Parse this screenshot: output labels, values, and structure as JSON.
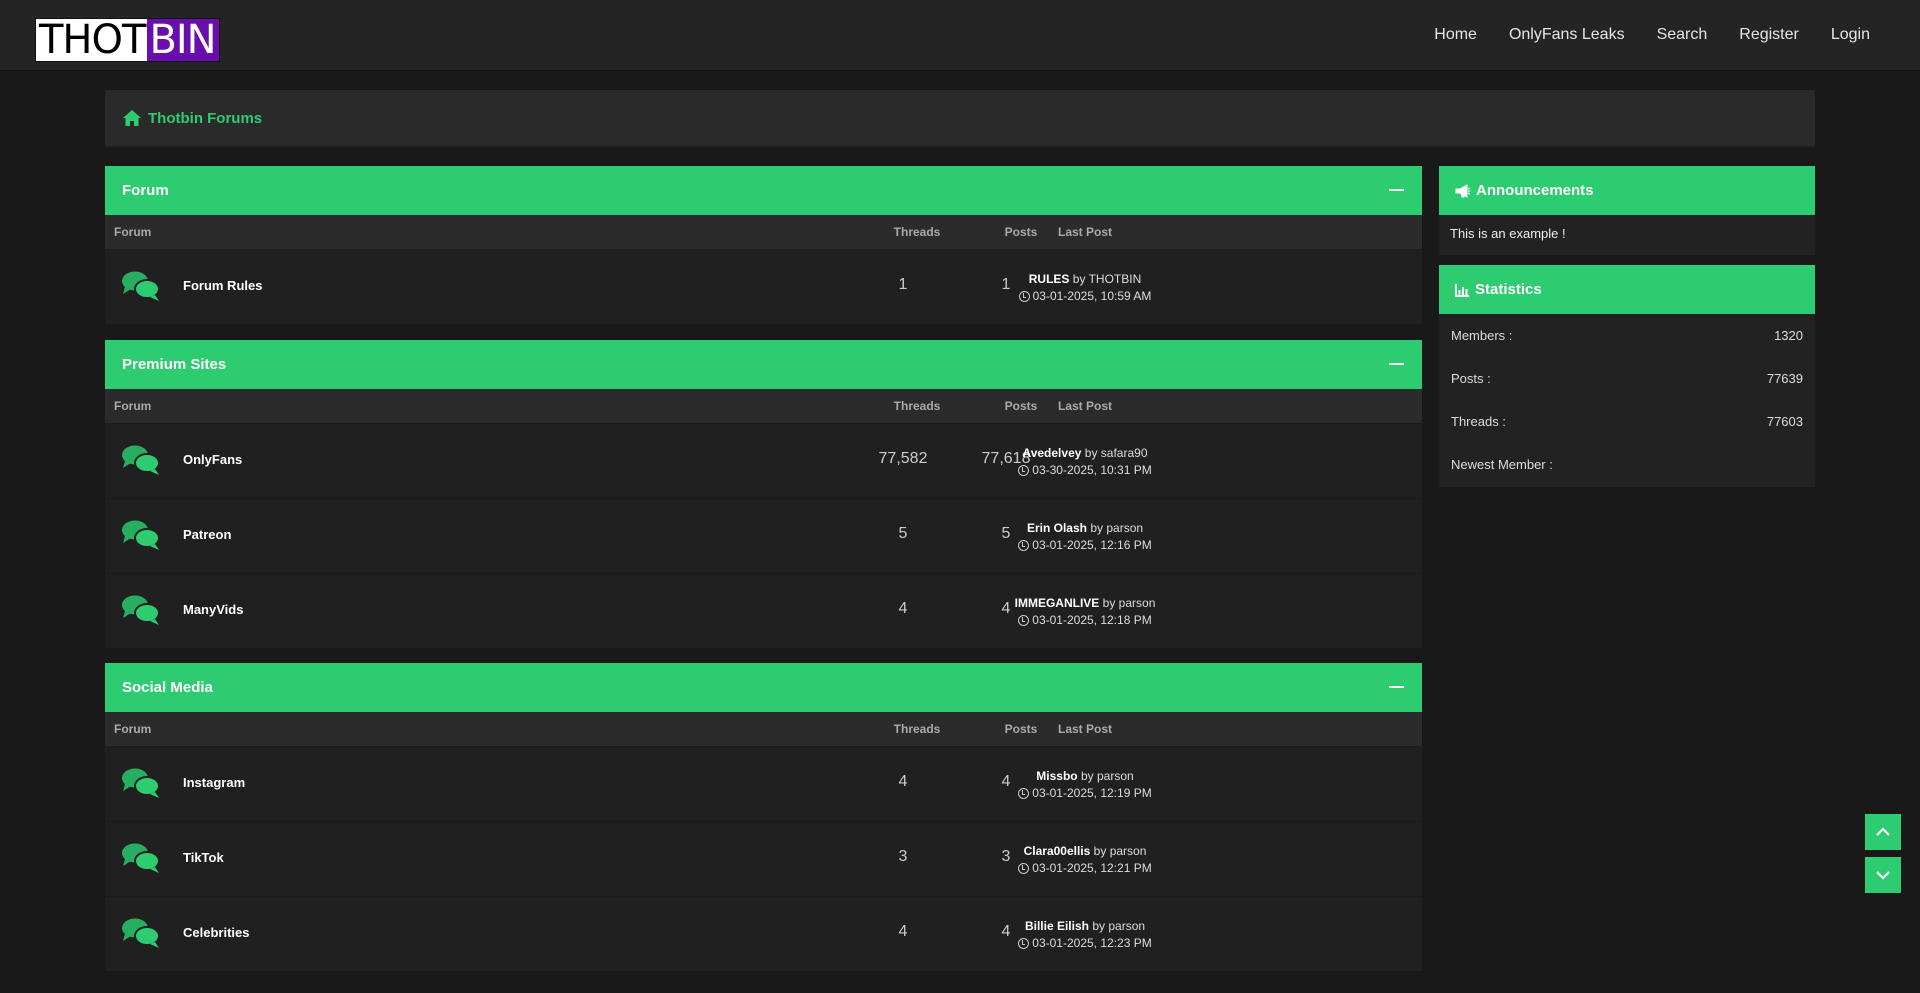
{
  "logo": {
    "part1": "THOT",
    "part2": "BIN"
  },
  "nav": [
    "Home",
    "OnlyFans Leaks",
    "Search",
    "Register",
    "Login"
  ],
  "breadcrumb": {
    "label": "Thotbin Forums"
  },
  "columns": {
    "forum": "Forum",
    "threads": "Threads",
    "posts": "Posts",
    "last_post": "Last Post"
  },
  "categories": [
    {
      "title": "Forum",
      "forums": [
        {
          "name": "Forum Rules",
          "threads": "1",
          "posts": "1",
          "last_title": "RULES",
          "by": "by",
          "last_user": "THOTBIN",
          "last_time": "03-01-2025, 10:59 AM"
        }
      ]
    },
    {
      "title": "Premium Sites",
      "forums": [
        {
          "name": "OnlyFans",
          "threads": "77,582",
          "posts": "77,618",
          "last_title": "Avedelvey",
          "by": "by",
          "last_user": "safara90",
          "last_time": "03-30-2025, 10:31 PM"
        },
        {
          "name": "Patreon",
          "threads": "5",
          "posts": "5",
          "last_title": "Erin Olash",
          "by": "by",
          "last_user": "parson",
          "last_time": "03-01-2025, 12:16 PM"
        },
        {
          "name": "ManyVids",
          "threads": "4",
          "posts": "4",
          "last_title": "IMMEGANLIVE",
          "by": "by",
          "last_user": "parson",
          "last_time": "03-01-2025, 12:18 PM"
        }
      ]
    },
    {
      "title": "Social Media",
      "forums": [
        {
          "name": "Instagram",
          "threads": "4",
          "posts": "4",
          "last_title": "Missbo",
          "by": "by",
          "last_user": "parson",
          "last_time": "03-01-2025, 12:19 PM"
        },
        {
          "name": "TikTok",
          "threads": "3",
          "posts": "3",
          "last_title": "Clara00ellis",
          "by": "by",
          "last_user": "parson",
          "last_time": "03-01-2025, 12:21 PM"
        },
        {
          "name": "Celebrities",
          "threads": "4",
          "posts": "4",
          "last_title": "Billie Eilish",
          "by": "by",
          "last_user": "parson",
          "last_time": "03-01-2025, 12:23 PM"
        }
      ]
    }
  ],
  "announcements": {
    "title": "Announcements",
    "text": "This is an example !"
  },
  "statistics": {
    "title": "Statistics",
    "rows": [
      {
        "label": "Members :",
        "value": "1320"
      },
      {
        "label": "Posts :",
        "value": "77639"
      },
      {
        "label": "Threads :",
        "value": "77603"
      },
      {
        "label": "Newest Member :",
        "value": ""
      }
    ]
  },
  "colors": {
    "accent": "#2ecc71",
    "logo_purple": "#6a0dad",
    "background": "#191919"
  },
  "icons": [
    "home-icon",
    "forum-bubbles-icon",
    "clock-icon",
    "megaphone-icon",
    "chart-icon",
    "chevron-up-icon",
    "chevron-down-icon"
  ]
}
